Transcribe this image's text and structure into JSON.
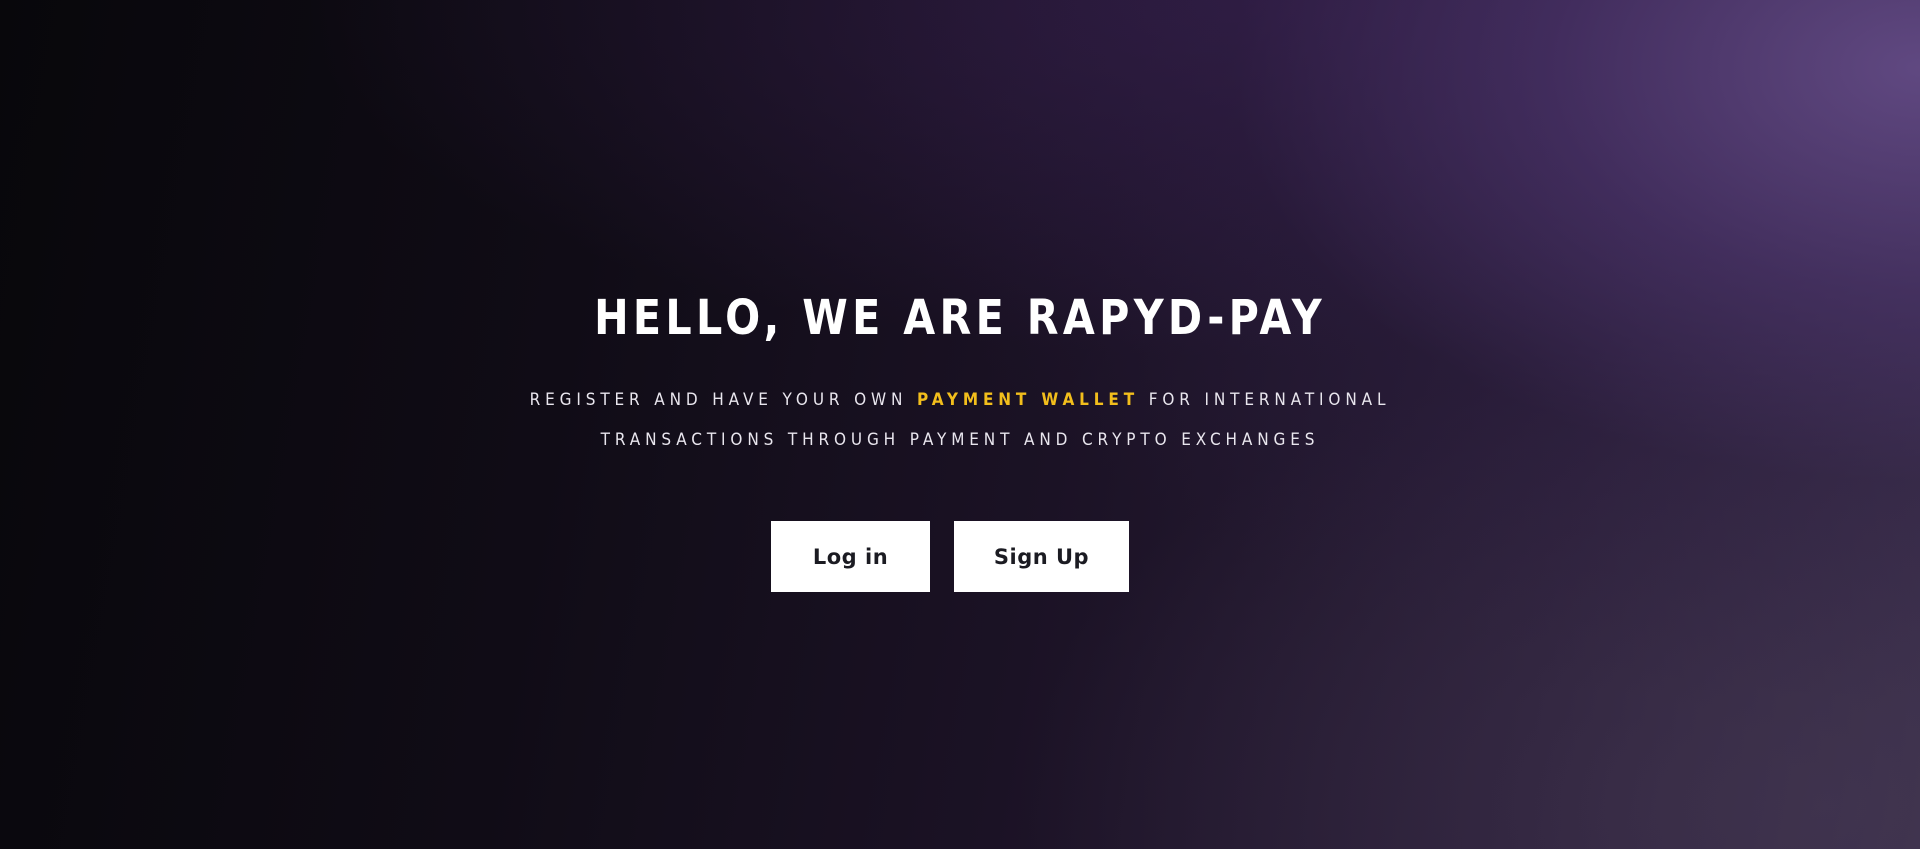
{
  "hero": {
    "title": "HELLO, WE ARE RAPYD-PAY",
    "subtitle": {
      "line1_before": "REGISTER AND HAVE YOUR OWN ",
      "line1_highlight": "PAYMENT WALLET",
      "line1_after": " FOR INTERNATIONAL",
      "line2": "TRANSACTIONS THROUGH PAYMENT AND CRYPTO EXCHANGES"
    }
  },
  "buttons": {
    "login_label": "Log in",
    "signup_label": "Sign Up"
  },
  "colors": {
    "highlight": "#f2be1c",
    "button_bg": "#ffffff",
    "button_text": "#1b1b22",
    "title_text": "#ffffff"
  }
}
